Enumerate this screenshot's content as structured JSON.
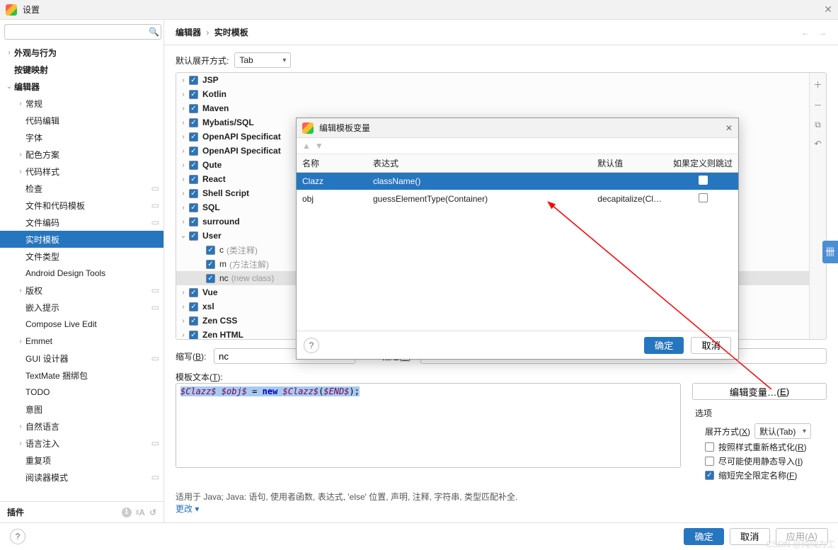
{
  "window": {
    "title": "设置"
  },
  "sidebar": {
    "search_placeholder": "",
    "plugins_label": "插件",
    "plugins_badge": "1",
    "items": [
      {
        "label": "外观与行为",
        "bold": true,
        "arrow": ">",
        "pad": 1
      },
      {
        "label": "按键映射",
        "bold": true,
        "arrow": "",
        "pad": 1
      },
      {
        "label": "编辑器",
        "bold": true,
        "arrow": "v",
        "pad": 1
      },
      {
        "label": "常规",
        "arrow": ">",
        "pad": 2
      },
      {
        "label": "代码编辑",
        "arrow": "",
        "pad": 2
      },
      {
        "label": "字体",
        "arrow": "",
        "pad": 2
      },
      {
        "label": "配色方案",
        "arrow": ">",
        "pad": 2
      },
      {
        "label": "代码样式",
        "arrow": ">",
        "pad": 2
      },
      {
        "label": "检查",
        "arrow": "",
        "pad": 2,
        "cfg": true
      },
      {
        "label": "文件和代码模板",
        "arrow": "",
        "pad": 2,
        "cfg": true
      },
      {
        "label": "文件编码",
        "arrow": "",
        "pad": 2,
        "cfg": true
      },
      {
        "label": "实时模板",
        "arrow": "",
        "pad": 2,
        "selected": true
      },
      {
        "label": "文件类型",
        "arrow": "",
        "pad": 2
      },
      {
        "label": "Android Design Tools",
        "arrow": "",
        "pad": 2
      },
      {
        "label": "版权",
        "arrow": ">",
        "pad": 2,
        "cfg": true
      },
      {
        "label": "嵌入提示",
        "arrow": "",
        "pad": 2,
        "cfg": true
      },
      {
        "label": "Compose Live Edit",
        "arrow": "",
        "pad": 2
      },
      {
        "label": "Emmet",
        "arrow": ">",
        "pad": 2
      },
      {
        "label": "GUI 设计器",
        "arrow": "",
        "pad": 2,
        "cfg": true
      },
      {
        "label": "TextMate 捆绑包",
        "arrow": "",
        "pad": 2
      },
      {
        "label": "TODO",
        "arrow": "",
        "pad": 2
      },
      {
        "label": "意图",
        "arrow": "",
        "pad": 2
      },
      {
        "label": "自然语言",
        "arrow": ">",
        "pad": 2
      },
      {
        "label": "语言注入",
        "arrow": ">",
        "pad": 2,
        "cfg": true
      },
      {
        "label": "重复项",
        "arrow": "",
        "pad": 2
      },
      {
        "label": "阅读器模式",
        "arrow": "",
        "pad": 2,
        "cfg": true
      }
    ]
  },
  "breadcrumb": {
    "a": "编辑器",
    "b": "实时模板"
  },
  "expand": {
    "label": "默认展开方式:",
    "value": "Tab"
  },
  "template_groups": [
    {
      "label": "JSP",
      "arrow": ">"
    },
    {
      "label": "Kotlin",
      "arrow": ">"
    },
    {
      "label": "Maven",
      "arrow": ">"
    },
    {
      "label": "Mybatis/SQL",
      "arrow": ">"
    },
    {
      "label": "OpenAPI Specificat",
      "arrow": ">"
    },
    {
      "label": "OpenAPI Specificat",
      "arrow": ">"
    },
    {
      "label": "Qute",
      "arrow": ">"
    },
    {
      "label": "React",
      "arrow": ">"
    },
    {
      "label": "Shell Script",
      "arrow": ">"
    },
    {
      "label": "SQL",
      "arrow": ">"
    },
    {
      "label": "surround",
      "arrow": ">"
    },
    {
      "label": "User",
      "arrow": "v",
      "children": [
        {
          "label": "c",
          "hint": "(类注释)"
        },
        {
          "label": "m",
          "hint": "(方法注解)"
        },
        {
          "label": "nc",
          "hint": "(new class)",
          "sel": true
        }
      ]
    },
    {
      "label": "Vue",
      "arrow": ">"
    },
    {
      "label": "xsl",
      "arrow": ">"
    },
    {
      "label": "Zen CSS",
      "arrow": ">"
    },
    {
      "label": "Zen HTML",
      "arrow": ">"
    }
  ],
  "abbrev": {
    "label_pre": "缩写(",
    "label_u": "B",
    "label_post": "):",
    "value": "nc"
  },
  "desc": {
    "label_pre": "描述(",
    "label_u": "D",
    "label_post": "):",
    "value": "new class"
  },
  "tmpltxt": {
    "label_pre": "模板文本(",
    "label_u": "T",
    "label_post": "):"
  },
  "code": {
    "v1": "$Clazz$",
    "v2": "$obj$",
    "eq": " = ",
    "kw": "new",
    "v3": " $Clazz$",
    "paren_open": "(",
    "v4": "$END$",
    "paren_close": ");"
  },
  "editvars_btn_pre": "编辑变量…(",
  "editvars_btn_u": "E",
  "editvars_btn_post": ")",
  "options": {
    "title": "选项",
    "expand_label_pre": "展开方式(",
    "expand_label_u": "X",
    "expand_label_post": ")",
    "expand_value": "默认(Tab)",
    "reformat_pre": "按照样式重新格式化(",
    "reformat_u": "R",
    "reformat_post": ")",
    "static_pre": "尽可能使用静态导入(",
    "static_u": "I",
    "static_post": ")",
    "fqn_pre": "缩短完全限定名称(",
    "fqn_u": "F",
    "fqn_post": ")"
  },
  "applies": {
    "text": "适用于 Java; Java: 语句, 使用者函数, 表达式, 'else' 位置, 声明, 注释, 字符串, 类型匹配补全.",
    "more": "更改 ▾"
  },
  "foot": {
    "ok": "确定",
    "cancel": "取消",
    "apply_pre": "应用(",
    "apply_u": "A",
    "apply_post": ")"
  },
  "dialog": {
    "title": "编辑模板变量",
    "cols": {
      "name": "名称",
      "expr": "表达式",
      "def": "默认值",
      "skip": "如果定义则跳过"
    },
    "rows": [
      {
        "name": "Clazz",
        "expr": "className()",
        "def": "",
        "skip": false,
        "sel": true
      },
      {
        "name": "obj",
        "expr": "guessElementType(Container)",
        "def": "decapitalize(Cl…",
        "skip": false
      }
    ],
    "ok": "确定",
    "cancel": "取消"
  },
  "watermark": "CSDN @纯纯力工",
  "side_tab": "卌"
}
